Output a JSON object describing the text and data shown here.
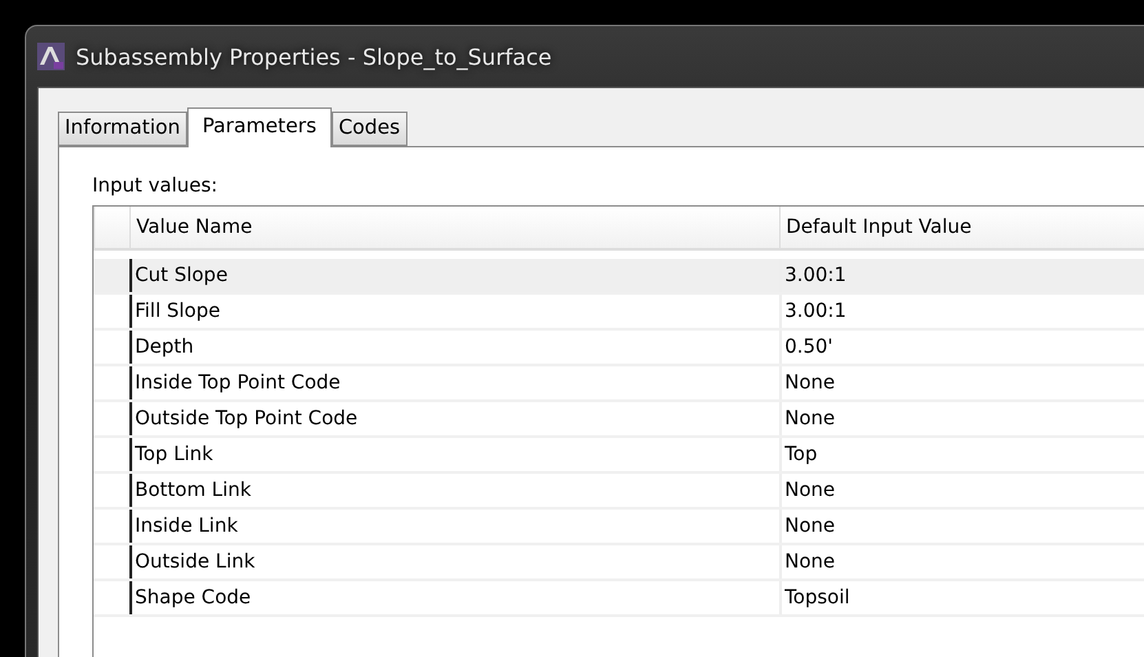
{
  "window": {
    "title": "Subassembly Properties - Slope_to_Surface"
  },
  "tabs": [
    {
      "label": "Information",
      "selected": false
    },
    {
      "label": "Parameters",
      "selected": true
    },
    {
      "label": "Codes",
      "selected": false
    }
  ],
  "section_label": "Input values:",
  "table": {
    "columns": [
      "Value Name",
      "Default Input Value"
    ],
    "rows": [
      {
        "name": "Cut Slope",
        "value": "3.00:1",
        "selected": true
      },
      {
        "name": "Fill Slope",
        "value": "3.00:1",
        "selected": false
      },
      {
        "name": "Depth",
        "value": "0.50'",
        "selected": false
      },
      {
        "name": "Inside Top Point Code",
        "value": "None",
        "selected": false
      },
      {
        "name": "Outside Top Point Code",
        "value": "None",
        "selected": false
      },
      {
        "name": "Top Link",
        "value": "Top",
        "selected": false
      },
      {
        "name": "Bottom Link",
        "value": "None",
        "selected": false
      },
      {
        "name": "Inside Link",
        "value": "None",
        "selected": false
      },
      {
        "name": "Outside Link",
        "value": "None",
        "selected": false
      },
      {
        "name": "Shape Code",
        "value": "Topsoil",
        "selected": false
      }
    ]
  }
}
